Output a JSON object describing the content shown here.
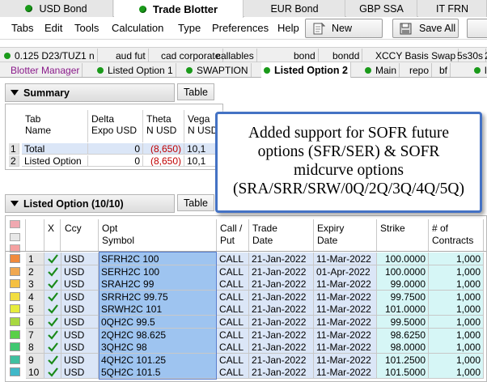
{
  "top_tabs": [
    {
      "label": "USD Bond",
      "dot": true,
      "active": false
    },
    {
      "label": "Trade Blotter",
      "dot": true,
      "active": true
    },
    {
      "label": "EUR Bond",
      "dot": false,
      "active": false
    },
    {
      "label": "GBP SSA",
      "dot": false,
      "active": false
    },
    {
      "label": "IT FRN",
      "dot": false,
      "active": false
    }
  ],
  "menu": [
    "Tabs",
    "Edit",
    "Tools",
    "Calculation",
    "Type",
    "Preferences",
    "Help"
  ],
  "toolbar": {
    "new_label": "New",
    "save_all_label": "Save All"
  },
  "filter_tabs": [
    "0.125 D23/TUZ1 n",
    "aud fut",
    "cad corporate",
    "callables",
    "bond",
    "bondd",
    "XCCY Basis Swap",
    "5s30s",
    "2/"
  ],
  "blotter_tabs": [
    {
      "label": "Blotter Manager",
      "dot": false,
      "active": false,
      "color": "#8a1a8a"
    },
    {
      "label": "Listed Option 1",
      "dot": true,
      "active": false
    },
    {
      "label": "SWAPTION",
      "dot": true,
      "active": false
    },
    {
      "label": "Listed Option 2",
      "dot": true,
      "active": true
    },
    {
      "label": "Main",
      "dot": true,
      "active": false
    },
    {
      "label": "repo",
      "dot": false,
      "active": false
    },
    {
      "label": "bf",
      "dot": false,
      "active": false
    },
    {
      "label": "li",
      "dot": true,
      "active": false
    }
  ],
  "summary": {
    "title": "Summary",
    "table_button": "Table",
    "columns": [
      [
        "Tab",
        "Name"
      ],
      [
        "Delta",
        "Expo USD"
      ],
      [
        "Theta",
        "N USD"
      ],
      [
        "Vega",
        "N USD"
      ]
    ],
    "rows": [
      {
        "idx": "1",
        "name": "Total",
        "delta": "0",
        "theta": "(8,650)",
        "vega": "10,1"
      },
      {
        "idx": "2",
        "name": "Listed Option",
        "delta": "0",
        "theta": "(8,650)",
        "vega": "10,1"
      }
    ]
  },
  "listed": {
    "title": "Listed Option (10/10)",
    "table_button": "Table",
    "columns": [
      [
        "X",
        ""
      ],
      [
        "Ccy",
        ""
      ],
      [
        "Opt",
        "Symbol"
      ],
      [
        "Call /",
        "Put"
      ],
      [
        "Trade",
        "Date"
      ],
      [
        "Expiry",
        "Date"
      ],
      [
        "Strike",
        ""
      ],
      [
        "# of",
        "Contracts"
      ]
    ],
    "rows": [
      {
        "idx": "1",
        "color": "#f08a3c",
        "ccy": "USD",
        "symbol": "SFRH2C 100",
        "cp": "CALL",
        "trade": "21-Jan-2022",
        "expiry": "11-Mar-2022",
        "strike": "100.0000",
        "contracts": "1,000"
      },
      {
        "idx": "2",
        "color": "#f0a850",
        "ccy": "USD",
        "symbol": "SERH2C 100",
        "cp": "CALL",
        "trade": "21-Jan-2022",
        "expiry": "01-Apr-2022",
        "strike": "100.0000",
        "contracts": "1,000"
      },
      {
        "idx": "3",
        "color": "#f5c040",
        "ccy": "USD",
        "symbol": "SRAH2C 99",
        "cp": "CALL",
        "trade": "21-Jan-2022",
        "expiry": "11-Mar-2022",
        "strike": "99.0000",
        "contracts": "1,000"
      },
      {
        "idx": "4",
        "color": "#f2de40",
        "ccy": "USD",
        "symbol": "SRRH2C 99.75",
        "cp": "CALL",
        "trade": "21-Jan-2022",
        "expiry": "11-Mar-2022",
        "strike": "99.7500",
        "contracts": "1,000"
      },
      {
        "idx": "5",
        "color": "#e6ec3c",
        "ccy": "USD",
        "symbol": "SRWH2C 101",
        "cp": "CALL",
        "trade": "21-Jan-2022",
        "expiry": "11-Mar-2022",
        "strike": "101.0000",
        "contracts": "1,000"
      },
      {
        "idx": "6",
        "color": "#a8d840",
        "ccy": "USD",
        "symbol": "0QH2C 99.5",
        "cp": "CALL",
        "trade": "21-Jan-2022",
        "expiry": "11-Mar-2022",
        "strike": "99.5000",
        "contracts": "1,000"
      },
      {
        "idx": "7",
        "color": "#58d048",
        "ccy": "USD",
        "symbol": "2QH2C 98.625",
        "cp": "CALL",
        "trade": "21-Jan-2022",
        "expiry": "11-Mar-2022",
        "strike": "98.6250",
        "contracts": "1,000"
      },
      {
        "idx": "8",
        "color": "#40c870",
        "ccy": "USD",
        "symbol": "3QH2C 98",
        "cp": "CALL",
        "trade": "21-Jan-2022",
        "expiry": "11-Mar-2022",
        "strike": "98.0000",
        "contracts": "1,000"
      },
      {
        "idx": "9",
        "color": "#40c0a0",
        "ccy": "USD",
        "symbol": "4QH2C 101.25",
        "cp": "CALL",
        "trade": "21-Jan-2022",
        "expiry": "11-Mar-2022",
        "strike": "101.2500",
        "contracts": "1,000"
      },
      {
        "idx": "10",
        "color": "#40b8c8",
        "ccy": "USD",
        "symbol": "5QH2C 101.5",
        "cp": "CALL",
        "trade": "21-Jan-2022",
        "expiry": "11-Mar-2022",
        "strike": "101.5000",
        "contracts": "1,000"
      }
    ]
  },
  "callout_lines": [
    "Added support for SOFR future",
    "options (SFR/SER) & SOFR",
    "midcurve options",
    "(SRA/SRR/SRW/0Q/2Q/3Q/4Q/5Q)"
  ],
  "colors": {
    "negative": "#c00000",
    "symbol_cell": "#9ec4f0",
    "row_cell": "#dbe6f7",
    "numeric_cell": "#d6f6f6",
    "check": "#1a8a1a",
    "callout_border": "#4472c4"
  }
}
